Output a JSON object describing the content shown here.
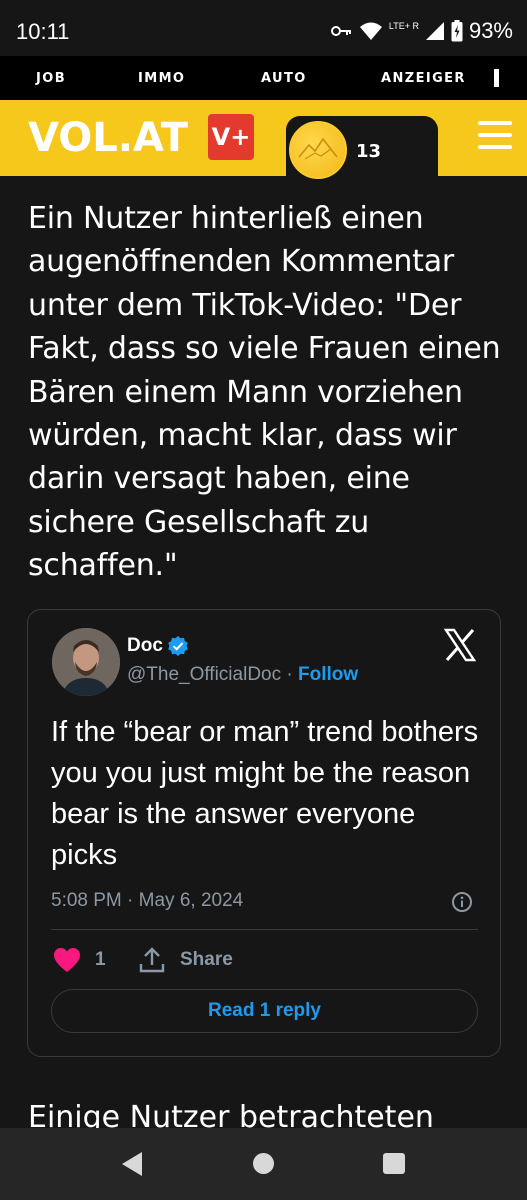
{
  "status_bar": {
    "time": "10:11",
    "network": "LTE+ R",
    "battery": "93%"
  },
  "top_nav": {
    "items": [
      "JOB",
      "IMMO",
      "AUTO",
      "ANZEIGER"
    ]
  },
  "header": {
    "logo": "VOL.AT",
    "vplus_label": "V+",
    "points_count": "13",
    "brand_color": "#f6c81b"
  },
  "article": {
    "paragraph_1": "Ein Nutzer hinterließ einen augenöffnenden Kommentar unter dem TikTok-Video: \"Der Fakt, dass so viele Frauen einen Bären einem Mann vorziehen würden, macht klar, dass wir darin versagt haben, eine sichere Gesellschaft zu schaffen.\"",
    "paragraph_2": "Einige Nutzer betrachteten"
  },
  "tweet": {
    "author_name": "Doc",
    "handle": "@The_OfficialDoc",
    "separator": "·",
    "follow_label": "Follow",
    "text": "If the “bear or man” trend bothers you you just might be the reason bear is the answer everyone picks",
    "timestamp": "5:08 PM · May 6, 2024",
    "like_count": "1",
    "share_label": "Share",
    "reply_button": "Read 1 reply",
    "accent_color": "#1d9bf0",
    "like_color": "#f91880"
  }
}
